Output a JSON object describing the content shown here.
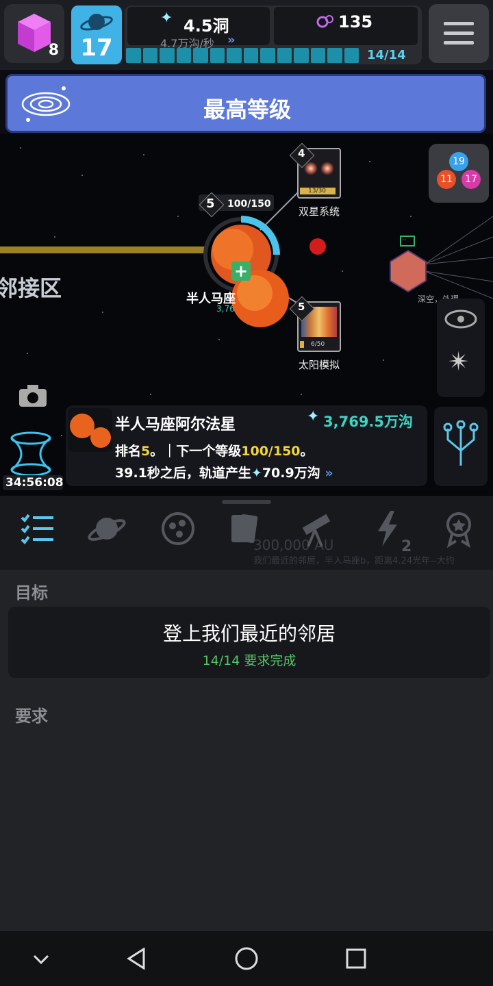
{
  "topbar": {
    "cube_count": "8",
    "level": "17",
    "energy_value": "4.5洞",
    "energy_rate": "4.7万沟/秒",
    "orbs_value": "135",
    "progress_text": "14/14",
    "progress_fraction": 1.0
  },
  "banner": {
    "title": "最高等级"
  },
  "map": {
    "zone_label": "邻接区",
    "main_star": {
      "rank": "5",
      "progress": "100/150",
      "label": "半人马座",
      "value": "3,76"
    },
    "node_binary": {
      "rank": "4",
      "label": "双星系统",
      "progress": "13/30"
    },
    "node_solar": {
      "rank": "5",
      "label": "太阳模拟",
      "progress": "6/50"
    },
    "node_deep": {
      "label": "深空，外理"
    },
    "cluster_numbers": [
      "19",
      "11",
      "17"
    ],
    "timer": "34:56:08"
  },
  "info": {
    "name": "半人马座阿尔法星",
    "value": "3,769.5万沟",
    "rank_prefix": "排名",
    "rank": "5",
    "next_level_prefix": "。｜下一个等级",
    "next_level": "100/150",
    "next_level_suffix": "。",
    "orbit_prefix": "39.1秒之后，轨道产生",
    "orbit_value": "70.9万沟"
  },
  "tabs": {
    "items": [
      "list-icon",
      "planet-icon",
      "cluster-icon",
      "cards-icon",
      "telescope-icon",
      "lightning-icon",
      "badge-icon"
    ],
    "lightning_count": "2",
    "ghost_distance": "300,000 AU",
    "ghost_text": "我们最近的邻居，半人马座b，距离4.24光年--大约"
  },
  "content": {
    "goal_label": "目标",
    "goal_title": "登上我们最近的邻居",
    "goal_status": "14/14 要求完成",
    "requirements_label": "要求"
  },
  "colors": {
    "accent_cyan": "#3fd3c4",
    "level_blue": "#3fb3e6",
    "banner_blue": "#5c78d8",
    "success_green": "#56c46a"
  }
}
